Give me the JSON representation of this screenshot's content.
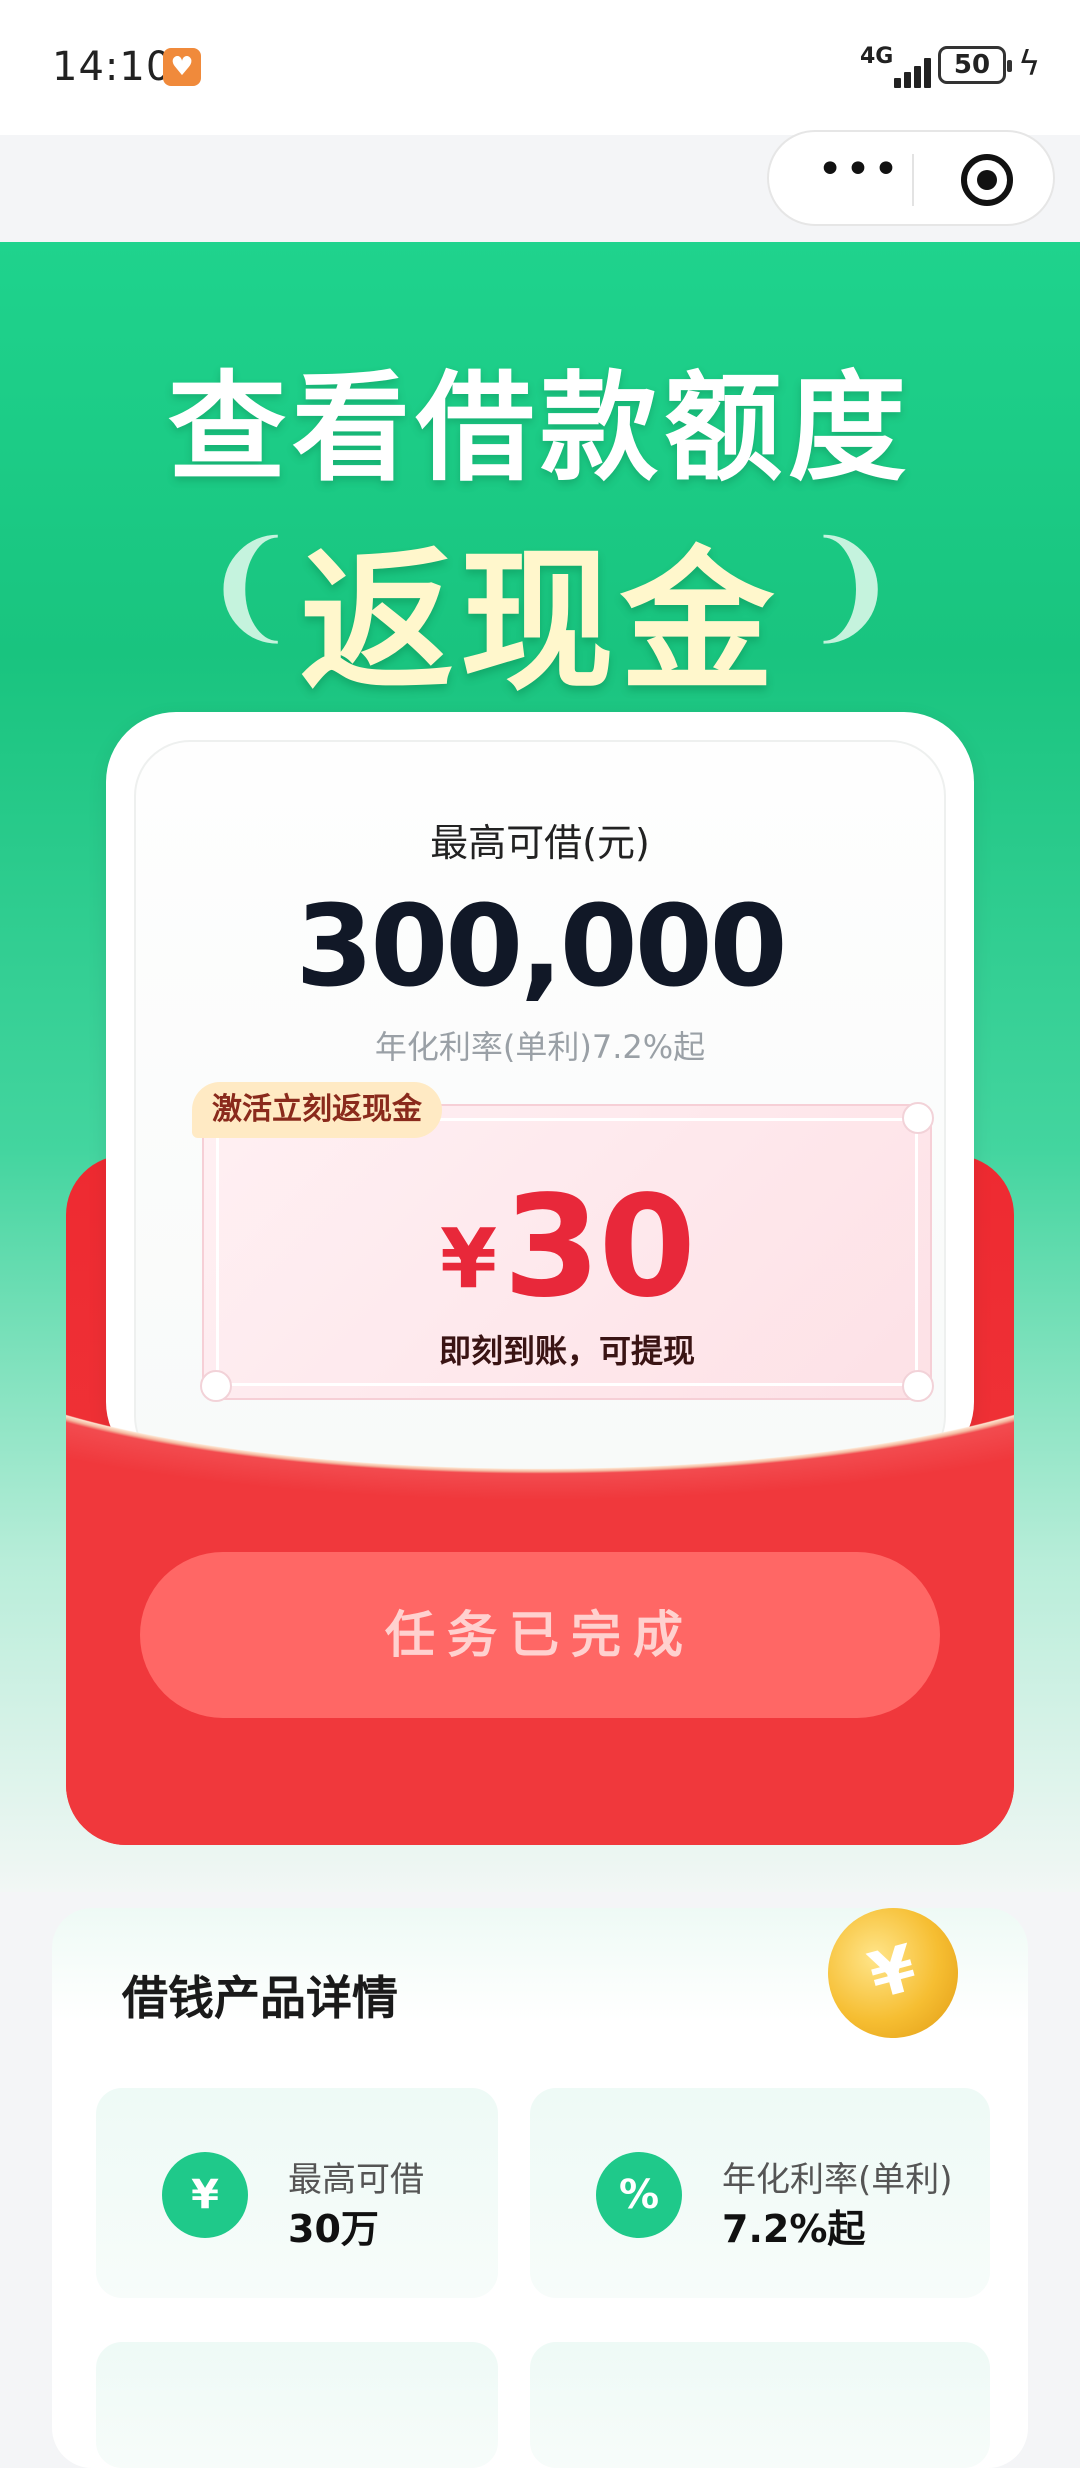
{
  "status_bar": {
    "time": "14:10",
    "network": "4G",
    "battery": "50"
  },
  "capsule": {
    "more_icon": "more-dots-icon",
    "close_icon": "target-close-icon"
  },
  "hero": {
    "title": "查看借款额度",
    "subtitle": "返现金"
  },
  "card": {
    "max_label": "最高可借(元)",
    "max_amount": "300,000",
    "rate_text": "年化利率(单利)7.2%起",
    "tag": "激活立刻返现金",
    "currency": "¥",
    "cash_value": "30",
    "cash_note": "即刻到账，可提现",
    "button_label": "任务已完成"
  },
  "details": {
    "title": "借钱产品详情",
    "items": [
      {
        "icon": "money-bag-icon",
        "glyph": "¥",
        "label": "最高可借",
        "value": "30万"
      },
      {
        "icon": "calendar-percent-icon",
        "glyph": "%",
        "label": "年化利率(单利)",
        "value": "7.2%起"
      }
    ]
  },
  "colors": {
    "brand_green": "#1fd38d",
    "envelope_red": "#f0383c",
    "cash_red": "#e8283a",
    "button_red": "#ff6765"
  }
}
